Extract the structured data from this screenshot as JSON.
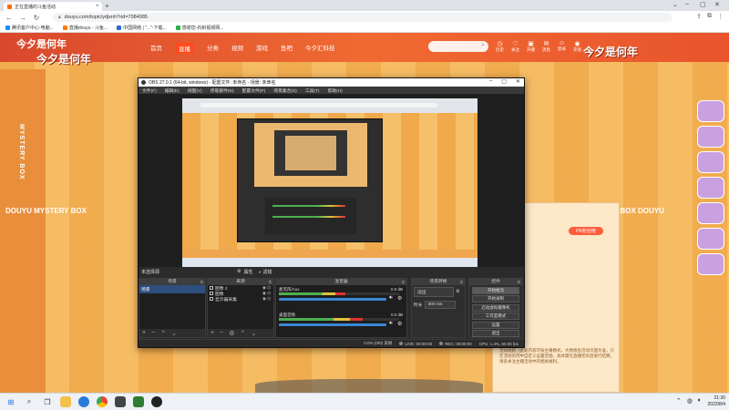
{
  "browser": {
    "tab_title": "正在直播的斗鱼活动",
    "url": "douyu.com/topic/ydjxnh?rid=7084085",
    "bookmarks": [
      {
        "label": "腾讯客户中心-电脑...",
        "color": "#1f8cff"
      },
      {
        "label": "直播douyu - 斗鱼...",
        "color": "#ff7a00"
      },
      {
        "label": "中国网络 | \"...\"-下载...",
        "color": "#2a6bd1"
      },
      {
        "label": "感谢您-石斛视频网...",
        "color": "#29b34a"
      }
    ]
  },
  "site": {
    "logo": "今夕是何年",
    "nav": [
      "首页",
      "直播",
      "分类",
      "视频",
      "游戏",
      "鱼吧",
      "今夕汇科技"
    ],
    "nav_active_index": 1,
    "banner_left": "今夕是何年",
    "banner_right": "今夕是何年",
    "user_icons": [
      "历史",
      "关注",
      "开播",
      "消息",
      "登录",
      "充值"
    ],
    "mystery_left": "DOUYU    MYSTERY BOX",
    "mystery_right": "MYSTERY BOX    DOUYU",
    "side_text": "MYSTERY BOX",
    "pk_button": "PK粉丝榜",
    "panel_text": "活动规则（此处内容可按主播模式，大致跑鱼活动页面为准，只在活动页内中自定义设置范围，具体需在直播完毕后进行结算，请多关注主播活动中的相关福利。"
  },
  "obs": {
    "title": "OBS 27.0.1 (64-bit, windows) - 配置文件: 未命名 - 场景: 未命名",
    "menu": [
      "文件(F)",
      "编辑(E)",
      "视图(V)",
      "停靠部件(D)",
      "配置文件(P)",
      "场景集合(S)",
      "工具(T)",
      "帮助(H)"
    ],
    "scene_bar": {
      "no_scene": "未选择源",
      "properties": "属性",
      "filters": "滤镜"
    },
    "docks": {
      "scenes": {
        "title": "场景",
        "items": [
          "场景"
        ]
      },
      "sources": {
        "title": "来源",
        "items": [
          "图像 2",
          "图像",
          "显示器采集"
        ]
      },
      "mixer": {
        "title": "混音器",
        "channels": [
          {
            "name": "麦克风/Aux",
            "db": "0.0 dB",
            "level": 0.55
          },
          {
            "name": "桌面音频",
            "db": "0.0 dB",
            "level": 0.7
          }
        ]
      },
      "transitions": {
        "title": "场景转换",
        "type": "淡出",
        "duration_label": "时长",
        "duration": "300 ms"
      },
      "controls": {
        "title": "控件",
        "buttons": [
          "开始推流",
          "开始录制",
          "启动虚拟摄像机",
          "工作室模式",
          "设置",
          "退出"
        ]
      }
    },
    "status": {
      "live": "LIVE: 00:00:00",
      "rec": "REC: 00:00:00",
      "cpu": "CPU: 1.4%, 60.00 fps",
      "dropped": "0.0% (0/0) 丢帧"
    }
  },
  "taskbar": {
    "time": "21:30",
    "date": "2022/8/4",
    "apps": [
      "start-icon",
      "search-icon",
      "task-view-icon",
      "file-explorer-icon",
      "edge-icon",
      "chrome-icon",
      "app-icon",
      "app-icon-2",
      "obs-icon"
    ]
  }
}
